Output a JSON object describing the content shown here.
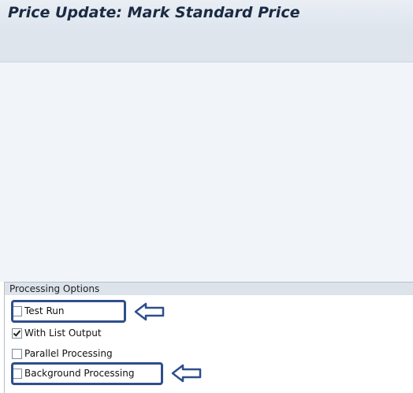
{
  "window": {
    "title": "Price Update: Mark Standard Price"
  },
  "processing_options": {
    "group_title": "Processing Options",
    "options": [
      {
        "label": "Test Run",
        "checked": false,
        "highlighted": true
      },
      {
        "label": "With List Output",
        "checked": true,
        "highlighted": false
      },
      {
        "label": "Parallel Processing",
        "checked": false,
        "highlighted": false
      },
      {
        "label": "Background Processing",
        "checked": false,
        "highlighted": true
      }
    ]
  },
  "annotations": {
    "highlight_color": "#2f4f8c",
    "arrow_icon": "left-arrow-icon"
  }
}
